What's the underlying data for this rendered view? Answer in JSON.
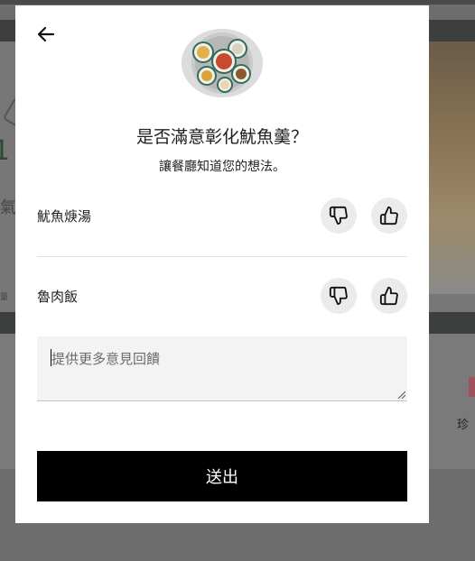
{
  "background": {
    "left_text_1": "1",
    "left_text_2": "氣",
    "left_text_3": "量",
    "right_label": "珍"
  },
  "modal": {
    "title": "是否滿意彰化魷魚羹？",
    "subtitle": "讓餐廳知道您的想法。",
    "dishes": [
      {
        "name": "魷魚焿湯"
      },
      {
        "name": "魯肉飯"
      }
    ],
    "feedback_placeholder": "提供更多意見回饋",
    "submit_label": "送出"
  },
  "icons": {
    "back": "arrow-left-icon",
    "thumbs_down": "thumbs-down-icon",
    "thumbs_up": "thumbs-up-icon",
    "resize": "resize-handle-icon"
  },
  "colors": {
    "overlay": "#6d6d6d",
    "modal_bg": "#ffffff",
    "button_bg": "#000000",
    "vote_bg": "#ebebeb",
    "input_bg": "#f3f3f3"
  }
}
